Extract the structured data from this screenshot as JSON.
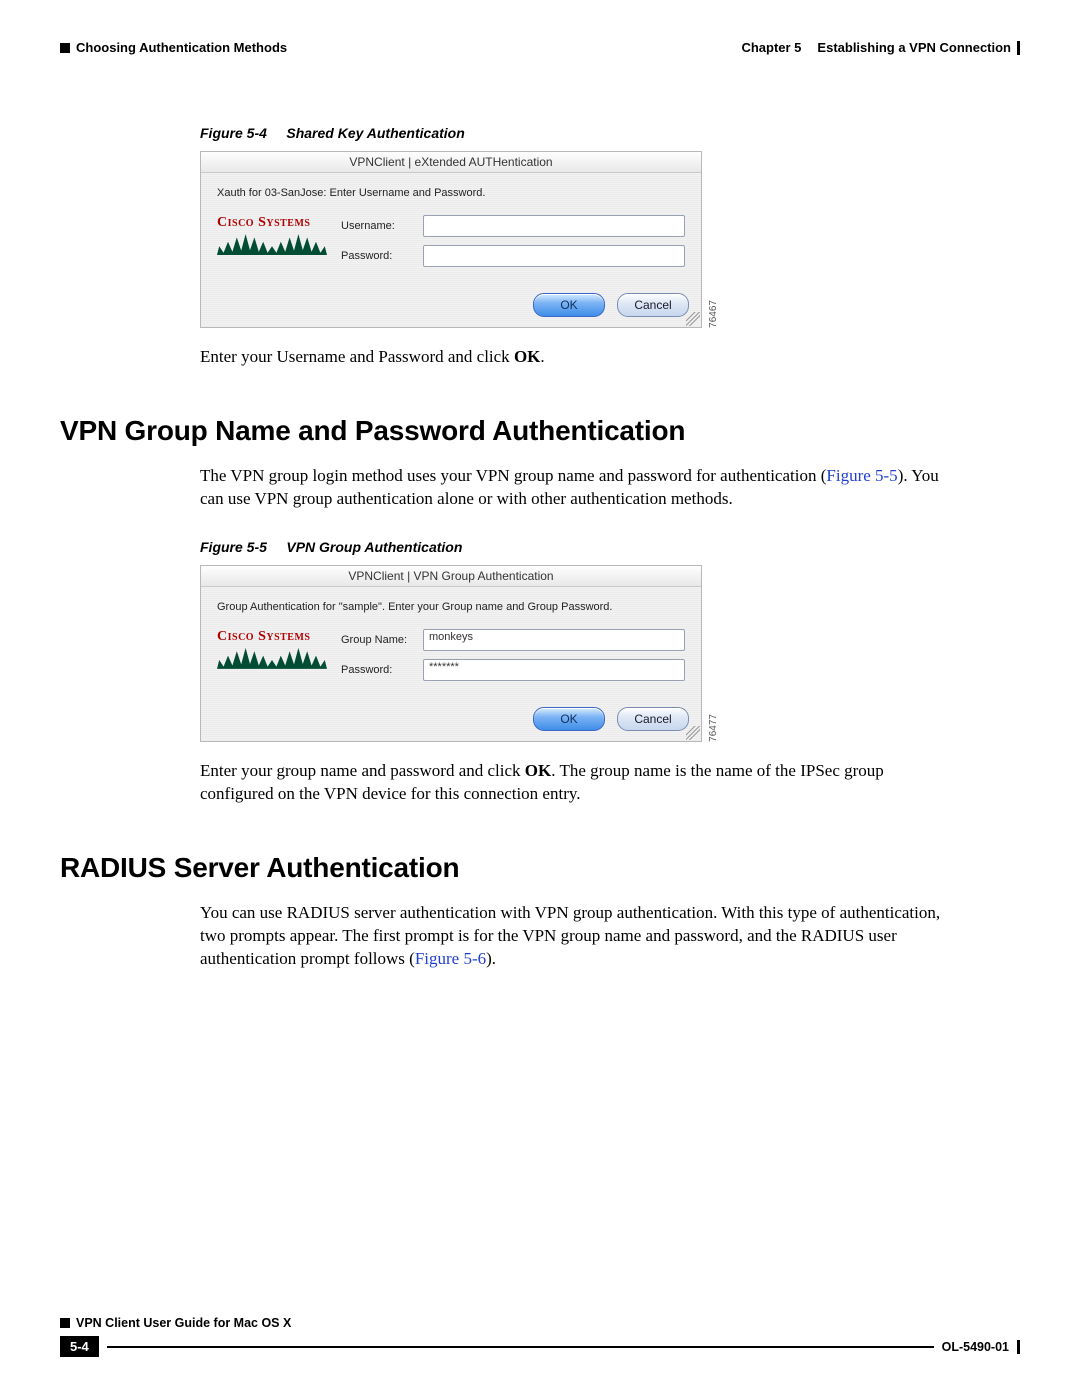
{
  "header": {
    "left": "Choosing Authentication Methods",
    "right_prefix": "Chapter 5",
    "right_title": "Establishing a VPN Connection"
  },
  "figure4": {
    "caption_prefix": "Figure 5-4",
    "caption_title": "Shared Key Authentication",
    "dialog_title": "VPNClient  |  eXtended AUTHentication",
    "prompt": "Xauth for 03-SanJose: Enter Username and Password.",
    "brand": "Cisco Systems",
    "label_username": "Username:",
    "label_password": "Password:",
    "value_username": "",
    "value_password": "",
    "ok": "OK",
    "cancel": "Cancel",
    "sidecode": "76467"
  },
  "para1_a": "Enter your Username and Password and click ",
  "para1_b": "OK",
  "para1_c": ".",
  "h_vpn_group": "VPN Group Name and Password Authentication",
  "para2_a": "The VPN group login method uses your VPN group name and password for authentication (",
  "para2_link": "Figure 5-5",
  "para2_b": "). You can use VPN group authentication alone or with other authentication methods.",
  "figure5": {
    "caption_prefix": "Figure 5-5",
    "caption_title": "VPN Group Authentication",
    "dialog_title": "VPNClient  |  VPN Group Authentication",
    "prompt": "Group Authentication for \"sample\".  Enter your Group name and Group Password.",
    "brand": "Cisco Systems",
    "label_groupname": "Group Name:",
    "label_password": "Password:",
    "value_groupname": "monkeys",
    "value_password": "*******",
    "ok": "OK",
    "cancel": "Cancel",
    "sidecode": "76477"
  },
  "para3_a": "Enter your group name and password and click ",
  "para3_b": "OK",
  "para3_c": ". The group name is the name of the IPSec group configured on the VPN device for this connection entry.",
  "h_radius": "RADIUS Server Authentication",
  "para4_a": "You can use RADIUS server authentication with VPN group authentication. With this type of authentication, two prompts appear. The first prompt is for the VPN group name and password, and the RADIUS user authentication prompt follows (",
  "para4_link": "Figure 5-6",
  "para4_b": ").",
  "footer": {
    "title": "VPN Client User Guide for Mac OS X",
    "page": "5-4",
    "doc": "OL-5490-01"
  }
}
